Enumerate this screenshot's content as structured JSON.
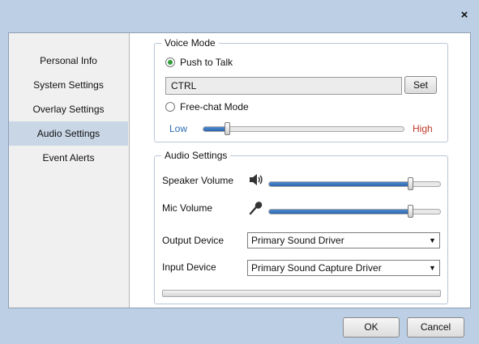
{
  "window": {
    "close_glyph": "×"
  },
  "sidebar": {
    "items": [
      {
        "label": "Personal Info"
      },
      {
        "label": "System Settings"
      },
      {
        "label": "Overlay Settings"
      },
      {
        "label": "Audio Settings",
        "active": true
      },
      {
        "label": "Event Alerts"
      }
    ]
  },
  "voice_mode": {
    "title": "Voice Mode",
    "push_to_talk_label": "Push to Talk",
    "push_to_talk_selected": true,
    "hotkey_value": "CTRL",
    "set_button": "Set",
    "free_chat_label": "Free-chat Mode",
    "free_chat_selected": false,
    "low_label": "Low",
    "high_label": "High",
    "sensitivity_fraction": 0.12,
    "low_color": "#2b6cb0",
    "high_color": "#c0392b"
  },
  "audio_settings": {
    "title": "Audio Settings",
    "speaker_volume_label": "Speaker Volume",
    "speaker_volume_fraction": 0.82,
    "speaker_icon": "speaker-icon",
    "mic_volume_label": "Mic Volume",
    "mic_volume_fraction": 0.82,
    "mic_icon": "microphone-icon",
    "output_device_label": "Output Device",
    "output_device_value": "Primary Sound Driver",
    "input_device_label": "Input Device",
    "input_device_value": "Primary Sound Capture Driver",
    "dropdown_icon": "chevron-down-icon"
  },
  "footer": {
    "ok_label": "OK",
    "cancel_label": "Cancel"
  },
  "colors": {
    "window_bg": "#bccfe4",
    "accent": "#2b64aa",
    "active_nav": "#c8d6e6"
  }
}
